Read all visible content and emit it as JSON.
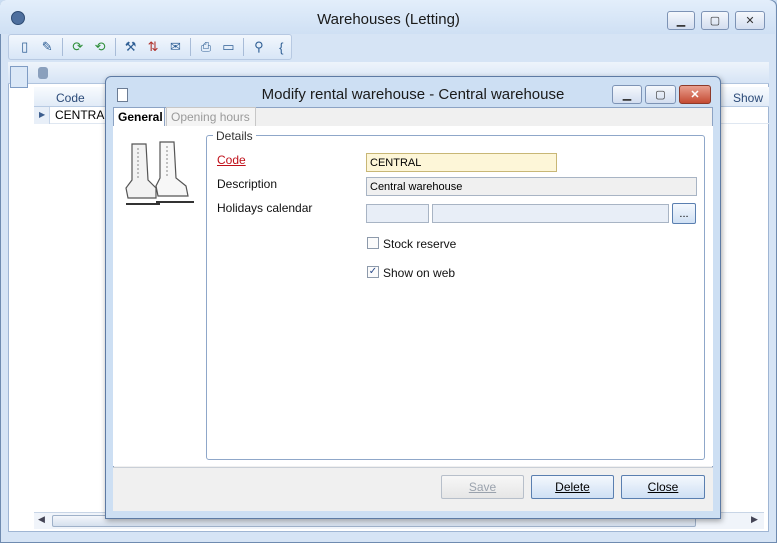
{
  "outer": {
    "title": "Warehouses (Letting)"
  },
  "grid": {
    "col_code": "Code",
    "col_show": "Show",
    "row1_code": "CENTRAL"
  },
  "dialog": {
    "title": "Modify rental warehouse - Central warehouse",
    "tabs": [
      {
        "label": "General"
      },
      {
        "label": "Opening hours"
      }
    ],
    "details_legend": "Details",
    "fields": {
      "code_label": "Code",
      "code_value": "CENTRAL",
      "description_label": "Description",
      "description_value": "Central warehouse",
      "holidays_label": "Holidays calendar",
      "holidays_code": "",
      "holidays_name": "",
      "browse_label": "..."
    },
    "checkboxes": [
      {
        "label": "Stock reserve",
        "checked": false
      },
      {
        "label": "Show on web",
        "checked": true
      }
    ],
    "buttons": {
      "save": "Save",
      "delete": "Delete",
      "close": "Close"
    }
  }
}
